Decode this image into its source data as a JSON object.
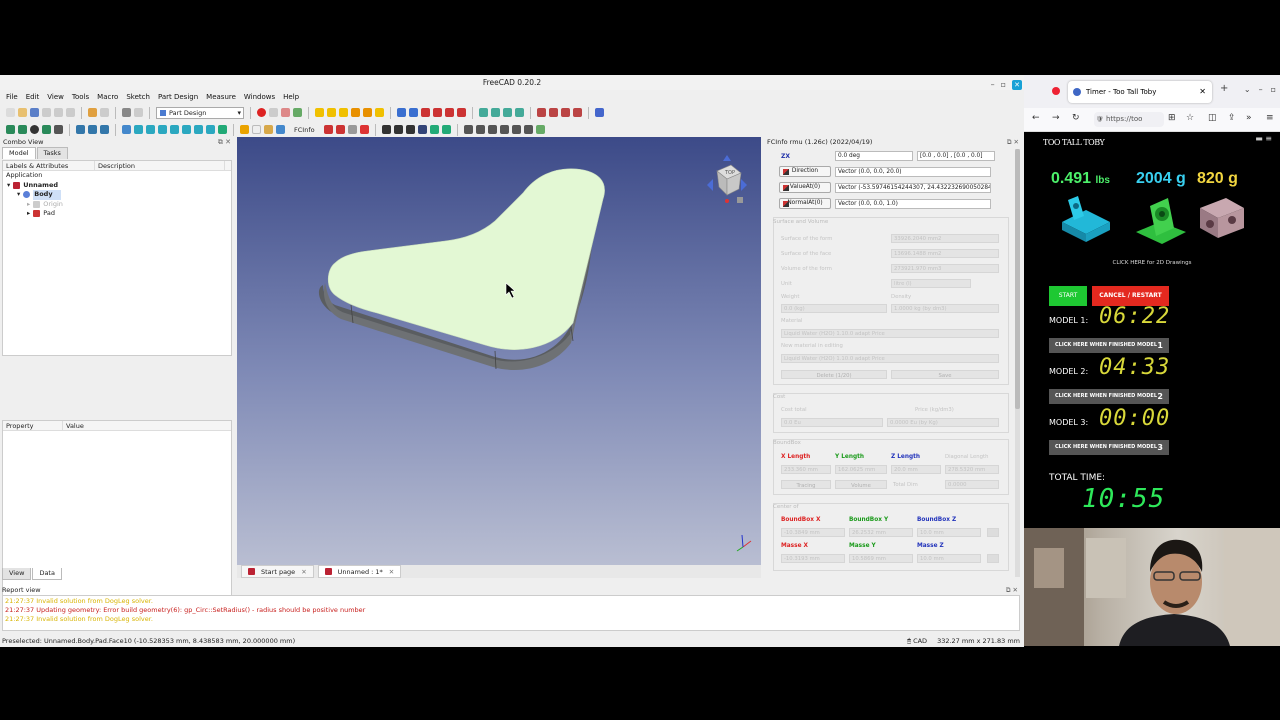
{
  "freecad": {
    "title": "FreeCAD 0.20.2",
    "menu": [
      "File",
      "Edit",
      "View",
      "Tools",
      "Macro",
      "Sketch",
      "Part Design",
      "Measure",
      "Windows",
      "Help"
    ],
    "workbench": "Part Design",
    "fcinfo_label": "FCInfo",
    "combo": {
      "title": "Combo View",
      "tabs": [
        "Model",
        "Tasks"
      ],
      "tree_headers": [
        "Labels & Attributes",
        "Description"
      ],
      "section": "Application",
      "tree": {
        "doc": "Unnamed",
        "body": "Body",
        "origin": "Origin",
        "pad": "Pad"
      },
      "prop_headers": [
        "Property",
        "Value"
      ],
      "bottom_tabs": [
        "View",
        "Data"
      ]
    },
    "doc_tabs": [
      "Start page",
      "Unnamed : 1*"
    ],
    "navcube_label": "TOP",
    "fcinfo": {
      "title": "FCInfo rmu (1.26c) (2022/04/19)",
      "zx_label": "ZX",
      "zx_value": "0.0 deg",
      "zx_extra": "[0.0 , 0.0] , [0.0 , 0.0]",
      "direction_btn": "Direction",
      "direction_val": "Vector (0.0, 0.0, 20.0)",
      "valueat_btn": "ValueAt(0)",
      "valueat_val": "Vector (-53.59746154244307, 24.432232690050284, 20.0)",
      "normalat_btn": "NormalAt(0)",
      "normalat_val": "Vector (0.0, 0.0, 1.0)",
      "ghost": {
        "surface_volume": "Surface and Volume",
        "surface_form": "Surface of the form",
        "surface_form_val": "33926.2040 mm2",
        "surface_face": "Surface of the face",
        "surface_face_val": "13696.1488 mm2",
        "volume_form": "Volume of the form",
        "volume_form_val": "273921.970 mm3",
        "unit": "Unit",
        "unit_val": "litre (l)",
        "weight": "Weight",
        "weight_val": "0.0 (kg)",
        "density": "Density",
        "density_val": "1.0000 kg (by dm3)",
        "material": "Material",
        "material_val": "Liquid Water (H2O) 1.10.0 adapt Price",
        "new_material": "New material in editing",
        "new_material_val": "Liquid Water (H2O) 1.10.0 adapt Price",
        "delete_btn": "Delete (1/20)",
        "save_btn": "Save",
        "cost": "Cost",
        "cost_total": "Cost total",
        "cost_total_val": "0.0 Eu",
        "price": "Price (kg/dm3)",
        "price_val": "0.0000 Eu (by Kg)",
        "boundbox": "BoundBox",
        "diag": "Diagonal Length",
        "xlen_val": "233.360 mm",
        "ylen_val": "162.0625 mm",
        "zlen_val": "20.0 mm",
        "diag_val": "278.5320 mm",
        "tracing_btn": "Tracing",
        "volume_btn": "Volume",
        "total_dim": "Total Dim",
        "total_dim_val": "0.0000",
        "center_of": "Center of",
        "bbx_val": "-10.3849 mm",
        "bby_val": "26.2532 mm",
        "bbz_val": "10.0 mm",
        "mx_val": "-10.3193 mm",
        "my_val": "10.5869 mm",
        "mz_val": "10.0 mm"
      },
      "x_length": "X Length",
      "y_length": "Y Length",
      "z_length": "Z Length",
      "bbx": "BoundBox X",
      "bby": "BoundBox Y",
      "bbz": "BoundBox Z",
      "mx": "Masse X",
      "my": "Masse Y",
      "mz": "Masse Z"
    },
    "report": {
      "title": "Report view",
      "lines": [
        {
          "text": "21:27:37  Invalid solution from DogLeg solver.",
          "level": "warn"
        },
        {
          "text": "21:27:37  Updating geometry: Error build geometry(6): gp_Circ::SetRadius() - radius should be positive number",
          "level": "err"
        },
        {
          "text": "21:27:37  Invalid solution from DogLeg solver.",
          "level": "warn"
        }
      ]
    },
    "status": {
      "left": "Preselected: Unnamed.Body.Pad.Face10 (-10.528353 mm, 8.438583 mm, 20.000000 mm)",
      "nav": "CAD",
      "dims": "332.27 mm x 271.83 mm"
    }
  },
  "firefox": {
    "tab_title": "Timer - Too Tall Toby",
    "url": "https://too",
    "page": {
      "logo": "TOO TALL TOBY",
      "weights": [
        {
          "value": "0.491",
          "unit": "lbs"
        },
        {
          "value": "2004",
          "unit": "g"
        },
        {
          "value": "820",
          "unit": "g"
        }
      ],
      "drawings_link": "CLICK HERE for 2D Drawings",
      "start": "START",
      "cancel": "CANCEL / RESTART",
      "models": [
        {
          "label": "MODEL 1:",
          "time": "06:22",
          "button": "CLICK HERE WHEN FINISHED MODEL",
          "num": "1"
        },
        {
          "label": "MODEL 2:",
          "time": "04:33",
          "button": "CLICK HERE WHEN FINISHED MODEL",
          "num": "2"
        },
        {
          "label": "MODEL 3:",
          "time": "00:00",
          "button": "CLICK HERE WHEN FINISHED MODEL",
          "num": "3"
        }
      ],
      "total_label": "TOTAL TIME:",
      "total_time": "10:55"
    }
  }
}
